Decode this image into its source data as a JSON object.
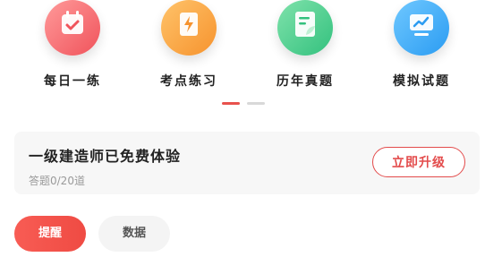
{
  "nav_grid": {
    "items": [
      {
        "label": "每日一练",
        "icon": "calendar-check-icon",
        "color": "#f0535b"
      },
      {
        "label": "考点练习",
        "icon": "lightning-book-icon",
        "color": "#f6932e"
      },
      {
        "label": "历年真题",
        "icon": "document-leaf-icon",
        "color": "#33c17e"
      },
      {
        "label": "模拟试题",
        "icon": "chart-board-icon",
        "color": "#2b9cf2"
      }
    ]
  },
  "pager": {
    "active_index": 0,
    "count": 2,
    "active_color": "#e8524d"
  },
  "trial_card": {
    "title": "一级建造师已免费体验",
    "progress_text": "答题0/20道",
    "upgrade_button": "立即升级"
  },
  "tabs": {
    "primary": "提醒",
    "secondary": "数据"
  }
}
